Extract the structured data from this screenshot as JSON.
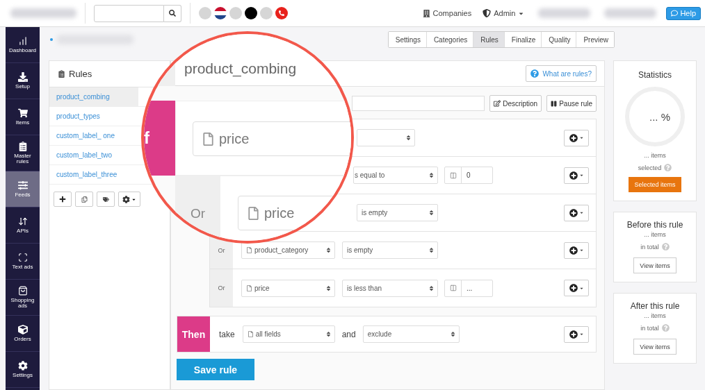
{
  "top_bar": {
    "account_dots": [
      {
        "kind": "dot",
        "color": "#d6d6d6"
      },
      {
        "kind": "flag"
      },
      {
        "kind": "dot",
        "color": "#d6d6d6"
      },
      {
        "kind": "dot",
        "color": "#000000"
      },
      {
        "kind": "dot",
        "color": "#d6d6d6"
      },
      {
        "kind": "phone",
        "color": "#e8211c"
      }
    ],
    "links": [
      {
        "label": "Companies",
        "dropdown": false
      },
      {
        "label": "Admin",
        "dropdown": true
      }
    ],
    "help": "Help"
  },
  "sidebar": {
    "items": [
      {
        "label": "Dashboard",
        "selected": false
      },
      {
        "label": "Setup",
        "selected": false
      },
      {
        "label": "Items",
        "selected": false
      },
      {
        "label": "Master rules",
        "selected": false
      },
      {
        "label": "Feeds",
        "selected": true
      },
      {
        "label": "APIs",
        "selected": false
      },
      {
        "label": "Text ads",
        "selected": false
      },
      {
        "label": "Shopping ads",
        "selected": false
      },
      {
        "label": "Orders",
        "selected": false
      },
      {
        "label": "Settings",
        "selected": false
      }
    ]
  },
  "steps": [
    {
      "label": "Settings",
      "selected": false
    },
    {
      "label": "Categories",
      "selected": false
    },
    {
      "label": "Rules",
      "selected": true
    },
    {
      "label": "Finalize",
      "selected": false
    },
    {
      "label": "Quality",
      "selected": false
    },
    {
      "label": "Preview",
      "selected": false
    }
  ],
  "rules_panel": {
    "title": "Rules",
    "items": [
      {
        "label": "product_combing",
        "selected": true
      },
      {
        "label": "product_types",
        "selected": false
      },
      {
        "label": "custom_label_ one",
        "selected": false
      },
      {
        "label": "custom_label_two",
        "selected": false
      },
      {
        "label": "custom_label_three",
        "selected": false
      }
    ]
  },
  "editor": {
    "help_link": "What are rules?",
    "actions": [
      "Description",
      "Pause rule"
    ],
    "conditions": [
      {
        "kind": "field"
      },
      {
        "kind": "condition",
        "operator": "s equal to",
        "value": "0"
      },
      {
        "kind": "or",
        "operator": "is empty"
      },
      {
        "kind": "or",
        "or_label": "Or",
        "field": "product_category",
        "operator": "is empty"
      },
      {
        "kind": "or",
        "or_label": "Or",
        "field": "price",
        "operator": "is less than",
        "value": "..."
      }
    ],
    "then": {
      "label": "Then",
      "take": "take",
      "field": "all fields",
      "joiner": "and",
      "action": "exclude"
    },
    "save": "Save rule"
  },
  "magnifier": {
    "title": "product_combing",
    "if_label": "f",
    "fields": [
      "price",
      "price"
    ],
    "or_label": "Or"
  },
  "statistics": {
    "title": "Statistics",
    "percent": "... %",
    "items": "... items",
    "selected": "selected",
    "button": "Selected items"
  },
  "before": {
    "title": "Before this rule",
    "items": "... items",
    "total": "in total",
    "button": "View items"
  },
  "after": {
    "title": "After this rule",
    "items": "... items",
    "total": "in total",
    "button": "View items"
  }
}
